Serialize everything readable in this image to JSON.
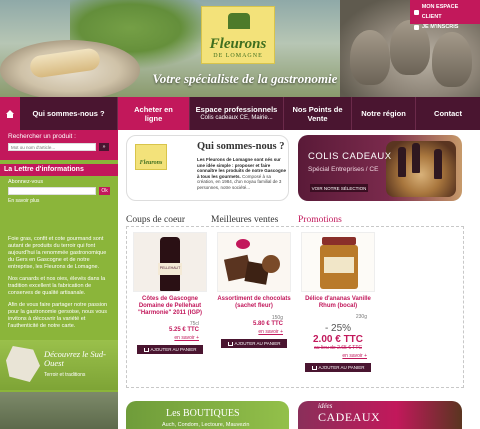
{
  "header": {
    "logo_name": "Fleurons",
    "logo_sub": "DE LOMAGNE",
    "tagline": "Votre spécialiste de la gastronomie",
    "client_links": [
      "MON ESPACE CLIENT",
      "JE M'INSCRIS"
    ]
  },
  "nav": {
    "items": [
      {
        "label": "Qui sommes-nous ?",
        "sub": ""
      },
      {
        "label": "Acheter en ligne",
        "sub": ""
      },
      {
        "label": "Espace professionnels",
        "sub": "Colis cadeaux CE, Mairie..."
      },
      {
        "label": "Nos Points de Vente",
        "sub": ""
      },
      {
        "label": "Notre région",
        "sub": ""
      },
      {
        "label": "Contact",
        "sub": ""
      }
    ]
  },
  "sidebar": {
    "search_label": "Rechercher un produit :",
    "search_placeholder": "Mot ou nom d'article...",
    "search_go": "»",
    "newsletter_title": "La Lettre d'informations",
    "newsletter_label": "Abonnez-vous",
    "newsletter_ok": "Ok",
    "newsletter_more": "En savoir plus",
    "intro": [
      "Foie gras, confit et cote gourmand sont autant de produits du terroir qui font aujourd'hui la renommée gastronomique du Gers en Gascogne et de notre entreprise, les Fleurons de Lomagne.",
      "Nos canards et nos oies, élevés dans la tradition excellent la fabrication de conserves de qualité artisanale.",
      "Afin de vous faire partager notre passion pour la gastronomie gersoise, nous vous invitons à découvrir la variété et l'authenticité de notre carte."
    ],
    "discover_title": "Découvrez le Sud-Ouest",
    "discover_sub": "Terroir et traditions"
  },
  "promo1": {
    "logo": "Fleurons",
    "title": "Qui sommes-nous ?",
    "body_bold": "Les Fleurons de Lomagne sont nés sur une idée simple : proposer et faire connaître les produits de notre Gascogne à tous les gourmets.",
    "body": "Composé à sa création, en 1984, d'un noyau familial de 3 personnes, notre société..."
  },
  "promo2": {
    "title": "COLIS CADEAUX",
    "subtitle": "Spécial Entreprises / CE",
    "button": "VOIR NOTRE SÉLECTION"
  },
  "tabs": [
    "Coups de coeur",
    "Meilleures ventes",
    "Promotions"
  ],
  "products": [
    {
      "name": "Côtes de Gascogne Domaine de Pellehaut \"Harmonie\" 2011 (IGP)",
      "qty": "75cl",
      "price": "5.25 € TTC",
      "more": "en savoir +",
      "cart": "AJOUTER AU PANIER",
      "label": "PELLEHAUT"
    },
    {
      "name": "Assortiment de chocolats (sachet fleur)",
      "qty": "150g",
      "price": "5.80 € TTC",
      "more": "en savoir +",
      "cart": "AJOUTER AU PANIER"
    },
    {
      "name": "Délice d'ananas Vanille Rhum (bocal)",
      "qty": "230g",
      "discount": "- 25%",
      "price": "2.00 € TTC",
      "old_price": "au lieu de 2.65 € TTC",
      "more": "en savoir +",
      "cart": "AJOUTER AU PANIER"
    }
  ],
  "bottom": {
    "boutiques_title": "Les BOUTIQUES",
    "boutiques_sub": "Auch, Condom, Lectoure, Mauvezin",
    "idees_pre": "idées",
    "idees_title": "CADEAUX"
  },
  "colors": {
    "accent": "#c2185b",
    "nav_dark": "#4a1530",
    "sidebar_green": "#8bb53a"
  }
}
